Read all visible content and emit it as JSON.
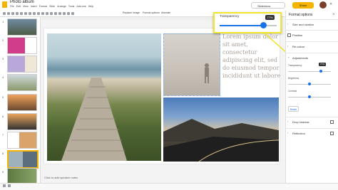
{
  "app": {
    "doc_title": "Photo album",
    "menu": [
      "File",
      "Edit",
      "View",
      "Insert",
      "Format",
      "Slide",
      "Arrange",
      "Tools",
      "Add-ons",
      "Help"
    ]
  },
  "header": {
    "slideshow_label": "Slideshow",
    "share_label": "Share"
  },
  "toolbar": {
    "replace_image_label": "Replace image",
    "format_options_label": "Format options",
    "animate_label": "Animate"
  },
  "filmstrip": {
    "slide_numbers": [
      "1",
      "2",
      "3",
      "4",
      "5",
      "6",
      "7",
      "8",
      "9"
    ],
    "selected_slide": "8"
  },
  "slide": {
    "lorem_text": "Lorem ipsum dolor sit amet, consectetur adipiscing elit, sed do eiusmod tempor incididunt ut labore",
    "speaker_notes_placeholder": "Click to add speaker notes"
  },
  "callout": {
    "label": "Transparency",
    "badge": "77%",
    "value_fraction": 0.77
  },
  "format_panel": {
    "title": "Format options",
    "sections": {
      "size_rotation": "Size and rotation",
      "position": "Position",
      "recolor": "Re-colour",
      "adjustments": "Adjustments",
      "drop_shadow": "Drop shadow",
      "reflection": "Reflection"
    },
    "sliders": {
      "transparency_label": "Transparency",
      "transparency_badge": "77%",
      "brightness_label": "Brightness",
      "contrast_label": "Contrast"
    },
    "reset_label": "Reset"
  },
  "colors": {
    "accent": "#1a73e8",
    "highlight": "#f2e52a",
    "brand": "#f4b400"
  }
}
